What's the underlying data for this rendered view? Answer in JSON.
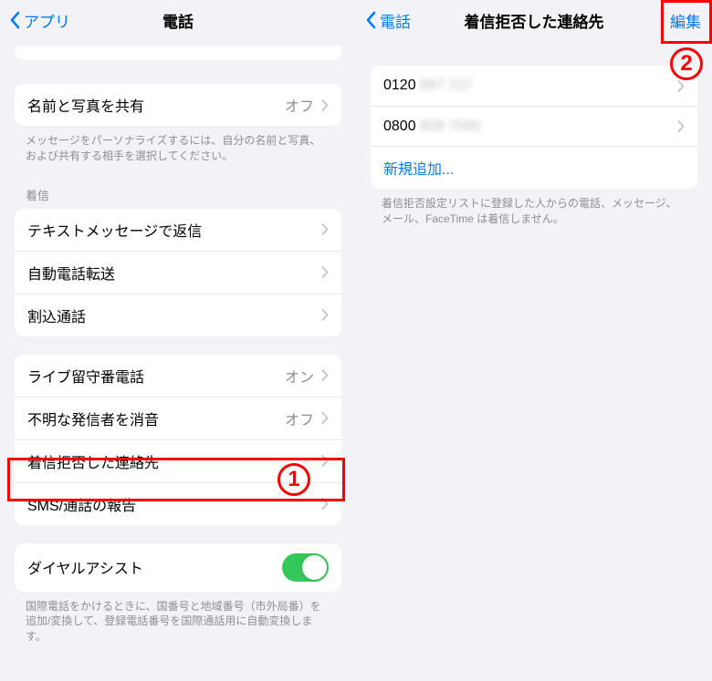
{
  "left": {
    "back": "アプリ",
    "title": "電話",
    "share": {
      "label": "名前と写真を共有",
      "value": "オフ",
      "footer": "メッセージをパーソナライズするには、自分の名前と写真、および共有する相手を選択してください。"
    },
    "incoming_header": "着信",
    "rows": {
      "text_reply": "テキストメッセージで返信",
      "call_forward": "自動電話転送",
      "call_waiting": "割込通話",
      "live_voicemail": "ライブ留守番電話",
      "live_voicemail_value": "オン",
      "silence_unknown": "不明な発信者を消音",
      "silence_unknown_value": "オフ",
      "blocked_contacts": "着信拒否した連絡先",
      "sms_report": "SMS/通話の報告",
      "dial_assist": "ダイヤルアシスト"
    },
    "dial_footer": "国際電話をかけるときに、国番号と地域番号（市外局番）を追加/変換して、登録電話番号を国際通話用に自動変換します。"
  },
  "right": {
    "back": "電話",
    "title": "着信拒否した連絡先",
    "edit": "編集",
    "numbers": [
      {
        "prefix": "0120",
        "rest": "887 237"
      },
      {
        "prefix": "0800",
        "rest": "808 7000"
      }
    ],
    "add_new": "新規追加...",
    "footer": "着信拒否設定リストに登録した人からの電話、メッセージ、メール、FaceTime は着信しません。"
  },
  "annotations": {
    "num1": "1",
    "num2": "2"
  }
}
